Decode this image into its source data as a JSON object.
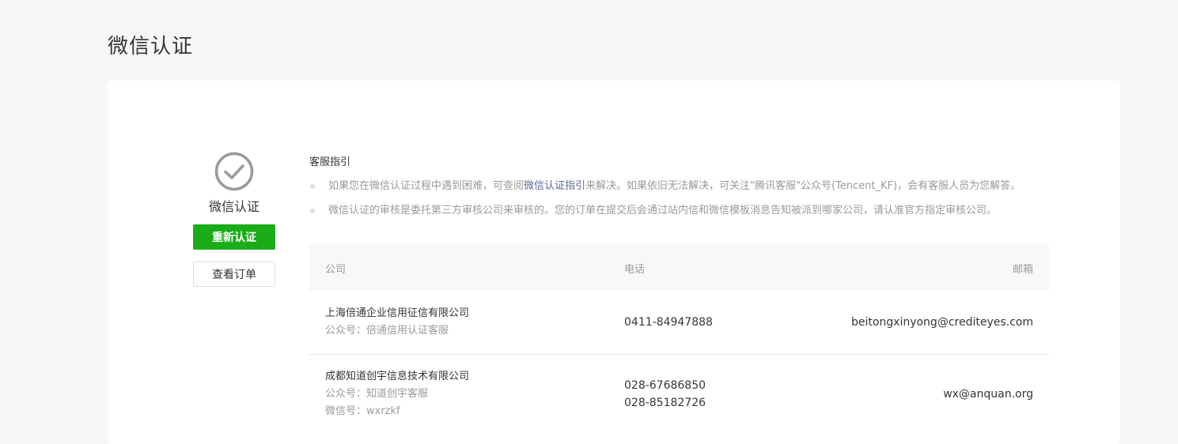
{
  "page": {
    "title": "微信认证"
  },
  "status": {
    "icon": "check-circle-icon",
    "label": "微信认证",
    "reauth_label": "重新认证",
    "view_order_label": "查看订单"
  },
  "colors": {
    "primary_green": "#1aad19",
    "link_blue": "#576b95",
    "muted_text": "#9a9a9a"
  },
  "guide": {
    "title": "客服指引",
    "item1": {
      "prefix": "如果您在微信认证过程中遇到困难，可查阅",
      "link": "微信认证指引",
      "suffix": "来解决。如果依旧无法解决，可关注\"腾讯客服\"公众号(Tencent_KF)，会有客服人员为您解答。"
    },
    "item2": "微信认证的审核是委托第三方审核公司来审核的。您的订单在提交后会通过站内信和微信模板消息告知被派到哪家公司，请认准官方指定审核公司。"
  },
  "table": {
    "headers": {
      "company": "公司",
      "phone": "电话",
      "email": "邮箱"
    },
    "rows": [
      {
        "company": "上海倍通企业信用征信有限公司",
        "official_account": "公众号：倍通信用认证客服",
        "phones": [
          "0411-84947888"
        ],
        "email": "beitongxinyong@crediteyes.com"
      },
      {
        "company": "成都知道创宇信息技术有限公司",
        "official_account": "公众号：知道创宇客服",
        "wechat_id": "微信号：wxrzkf",
        "phones": [
          "028-67686850",
          "028-85182726"
        ],
        "email": "wx@anquan.org"
      }
    ]
  }
}
